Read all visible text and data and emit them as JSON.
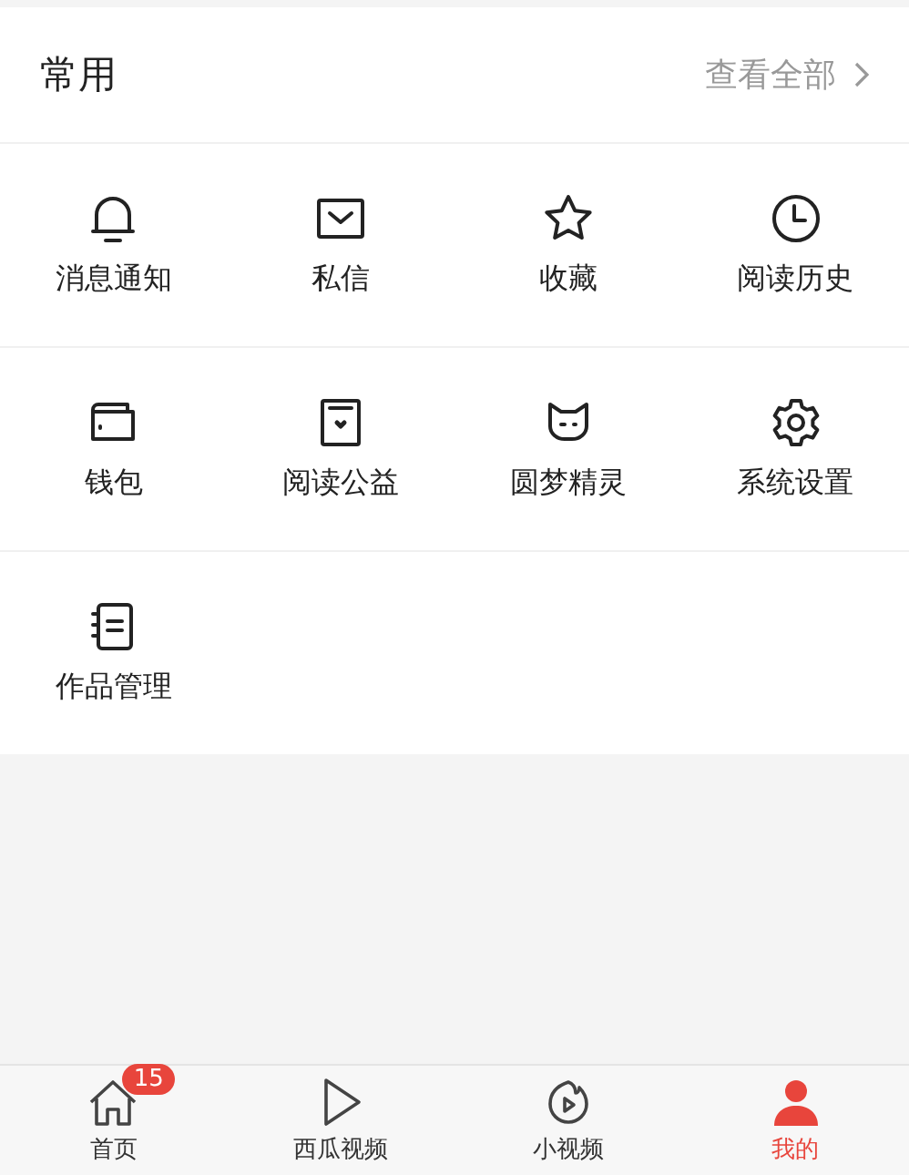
{
  "section": {
    "title": "常用",
    "link": "查看全部"
  },
  "rows": [
    [
      {
        "label": "消息通知"
      },
      {
        "label": "私信"
      },
      {
        "label": "收藏"
      },
      {
        "label": "阅读历史"
      }
    ],
    [
      {
        "label": "钱包"
      },
      {
        "label": "阅读公益"
      },
      {
        "label": "圆梦精灵"
      },
      {
        "label": "系统设置"
      }
    ],
    [
      {
        "label": "作品管理"
      }
    ]
  ],
  "tabs": [
    {
      "label": "首页",
      "badge": "15",
      "selected": false
    },
    {
      "label": "西瓜视频",
      "selected": false
    },
    {
      "label": "小视频",
      "selected": false
    },
    {
      "label": "我的",
      "selected": true
    }
  ]
}
